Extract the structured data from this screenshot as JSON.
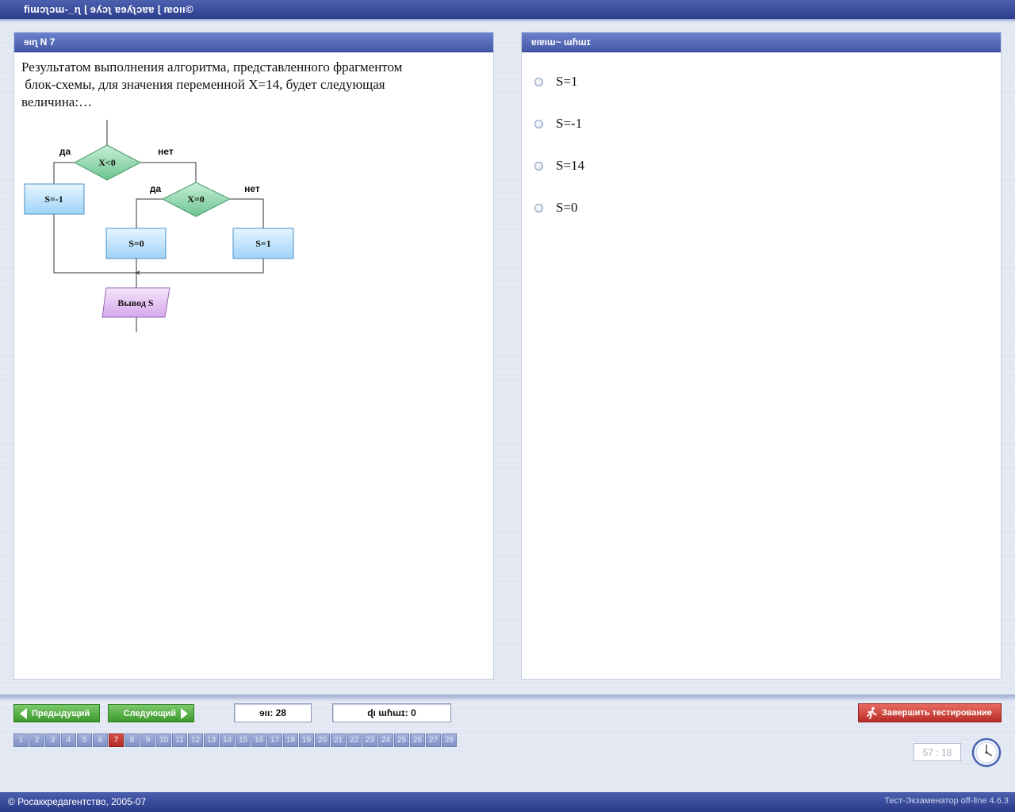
{
  "window": {
    "title": "ﬁɯɔʅɔɯ-_ɳ ɭ ɘʎɔʅ ɐɘʎʅɔɐɐ ɭ ıɐoıı©"
  },
  "question_panel": {
    "header": "ɘıɳ N 7",
    "text": "Результатом выполнения алгоритма, представленного фрагментом\n блок-схемы, для значения переменной X=14, будет следующая\nвеличина:…",
    "flowchart": {
      "cond1": "X<0",
      "cond1_yes": "да",
      "cond1_no": "нет",
      "assign1": "S=-1",
      "cond2": "X=0",
      "cond2_yes": "да",
      "cond2_no": "нет",
      "assign2": "S=0",
      "assign3": "S=1",
      "output": "Вывод S"
    }
  },
  "answers_panel": {
    "header": "ɐıɐıɯ~ ɯɦɯɪ",
    "options": [
      "S=1",
      "S=-1",
      "S=14",
      "S=0"
    ]
  },
  "navigation": {
    "prev_label": "Предыдущий",
    "next_label": "Следующий",
    "total_counter": "ɘıı: 28",
    "answered_counter": "ɖı ɯɦɯɪ: 0",
    "finish_label": "Завершить тестирование",
    "pages": [
      "1",
      "2",
      "3",
      "4",
      "5",
      "6",
      "7",
      "8",
      "9",
      "10",
      "11",
      "12",
      "13",
      "14",
      "15",
      "16",
      "17",
      "18",
      "19",
      "20",
      "21",
      "22",
      "23",
      "24",
      "25",
      "26",
      "27",
      "28"
    ],
    "current_page": "7",
    "timer": "57 : 18"
  },
  "footer": {
    "copyright": "© Росаккредагентство, 2005-07",
    "version": "Тест-Экзаменатор off-line 4.6.3"
  },
  "colors": {
    "header_blue": "#4459a8",
    "nav_green": "#3c9a2e",
    "finish_red": "#b92d27",
    "current_page_red": "#b12a24"
  }
}
